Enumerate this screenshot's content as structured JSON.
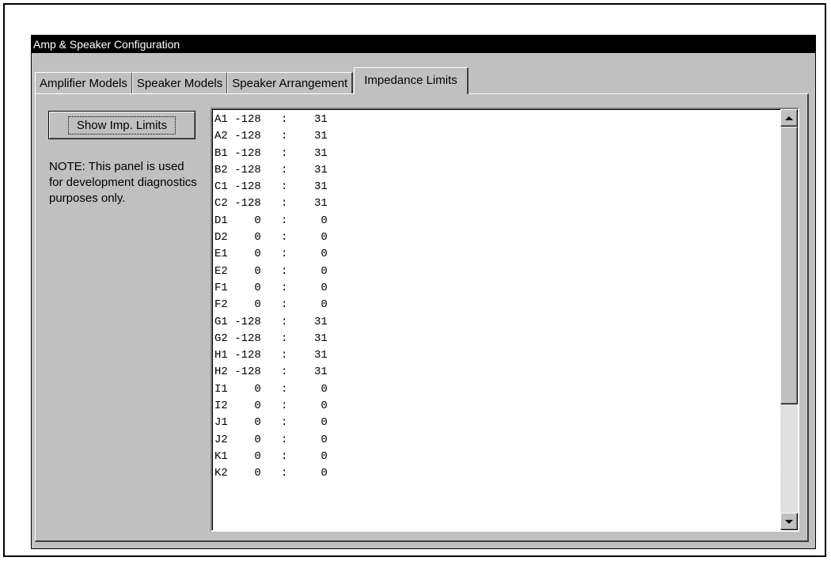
{
  "window": {
    "title": "Amp & Speaker Configuration"
  },
  "tabs": [
    {
      "label": "Amplifier Models"
    },
    {
      "label": "Speaker Models"
    },
    {
      "label": "Speaker Arrangement"
    },
    {
      "label": "Impedance Limits",
      "active": true
    }
  ],
  "panel": {
    "button_label": "Show Imp. Limits",
    "note": "NOTE: This panel is used for development diagnostics purposes only."
  },
  "impedance_list": {
    "scroll_position": 0.0,
    "rows": [
      "A1 -128   :    31",
      "A2 -128   :    31",
      "B1 -128   :    31",
      "B2 -128   :    31",
      "C1 -128   :    31",
      "C2 -128   :    31",
      "D1    0   :     0",
      "D2    0   :     0",
      "E1    0   :     0",
      "E2    0   :     0",
      "F1    0   :     0",
      "F2    0   :     0",
      "G1 -128   :    31",
      "G2 -128   :    31",
      "H1 -128   :    31",
      "H2 -128   :    31",
      "I1    0   :     0",
      "I2    0   :     0",
      "J1    0   :     0",
      "J2    0   :     0",
      "K1    0   :     0",
      "K2    0   :     0"
    ]
  }
}
